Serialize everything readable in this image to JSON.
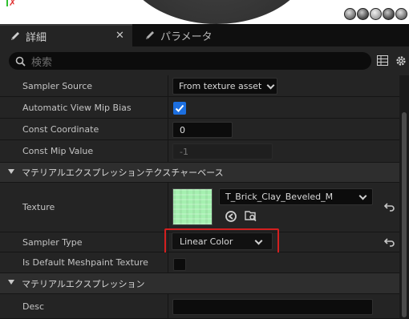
{
  "tabs": [
    {
      "label": "詳細",
      "icon": "pencil-icon",
      "active": true
    },
    {
      "label": "パラメータ",
      "icon": "pencil-icon",
      "active": false
    }
  ],
  "search": {
    "placeholder": "検索"
  },
  "properties": {
    "sampler_source": {
      "name": "Sampler Source",
      "value": "From texture asset"
    },
    "auto_view_mip_bias": {
      "name": "Automatic View Mip Bias",
      "checked": true
    },
    "const_coordinate": {
      "name": "Const Coordinate",
      "value": "0"
    },
    "const_mip_value": {
      "name": "Const Mip Value",
      "value": "-1"
    }
  },
  "category_texture_base": {
    "label": "マテリアルエクスプレッションテクスチャーベース"
  },
  "texture": {
    "name": "Texture",
    "asset": "T_Brick_Clay_Beveled_M"
  },
  "sampler_type": {
    "name": "Sampler Type",
    "value": "Linear Color"
  },
  "is_default_meshpaint": {
    "name": "Is Default Meshpaint Texture",
    "checked": false
  },
  "category_expression": {
    "label": "マテリアルエクスプレッション"
  },
  "desc": {
    "name": "Desc",
    "value": ""
  },
  "colors": {
    "highlight": "#d41f1f",
    "checkbox_on": "#1c6fe0",
    "thumbnail": "#a5f0b0"
  }
}
